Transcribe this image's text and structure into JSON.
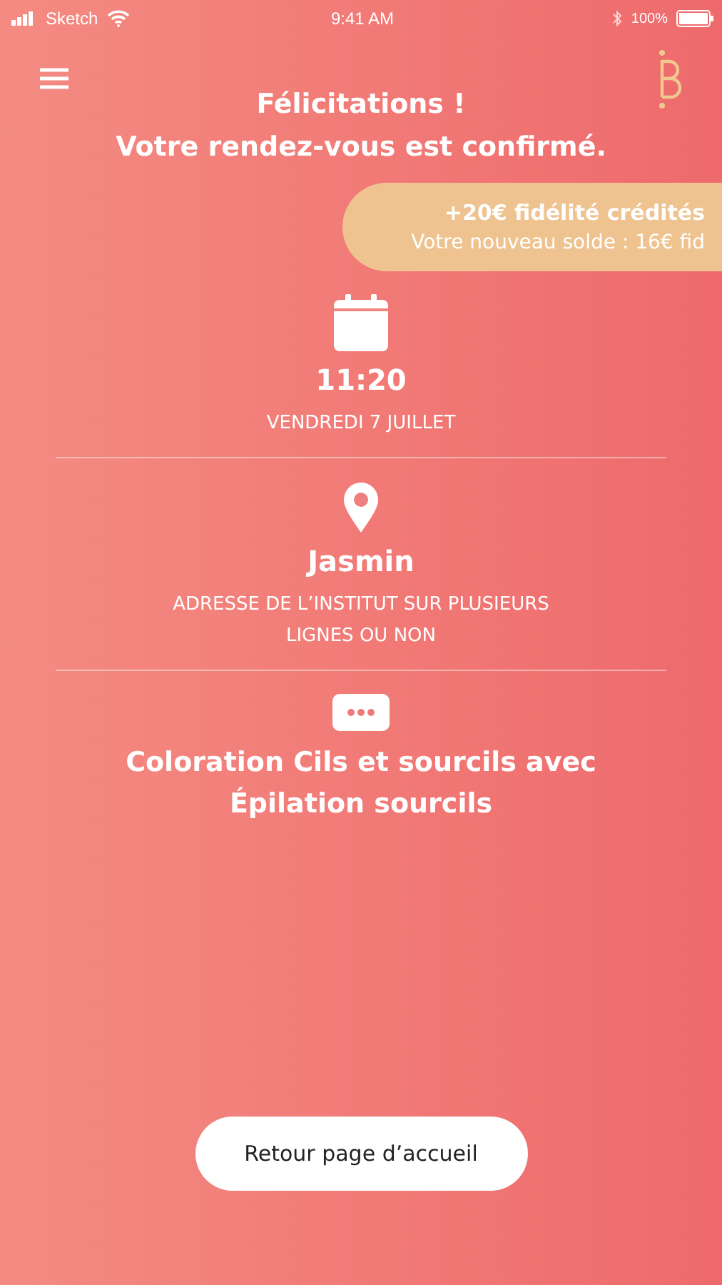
{
  "status_bar": {
    "carrier": "Sketch",
    "time": "9:41 AM",
    "battery": "100%"
  },
  "title": [
    "Félicitations !",
    "Votre rendez-vous est confirmé."
  ],
  "loyalty_banner": {
    "headline": "+20€ fidélité crédités",
    "balance": "Votre nouveau solde : 16€ fid"
  },
  "details": [
    {
      "kind": "date",
      "primary": "11:20",
      "secondary": "VENDREDI 7 JUILLET"
    },
    {
      "kind": "place",
      "primary": "Jasmin",
      "secondary": "ADRESSE DE L’INSTITUT SUR PLUSIEURS LIGNES OU NON"
    },
    {
      "kind": "service",
      "primary": "Coloration Cils et sourcils avec Épilation sourcils"
    }
  ],
  "button": "Retour page d’accueil"
}
